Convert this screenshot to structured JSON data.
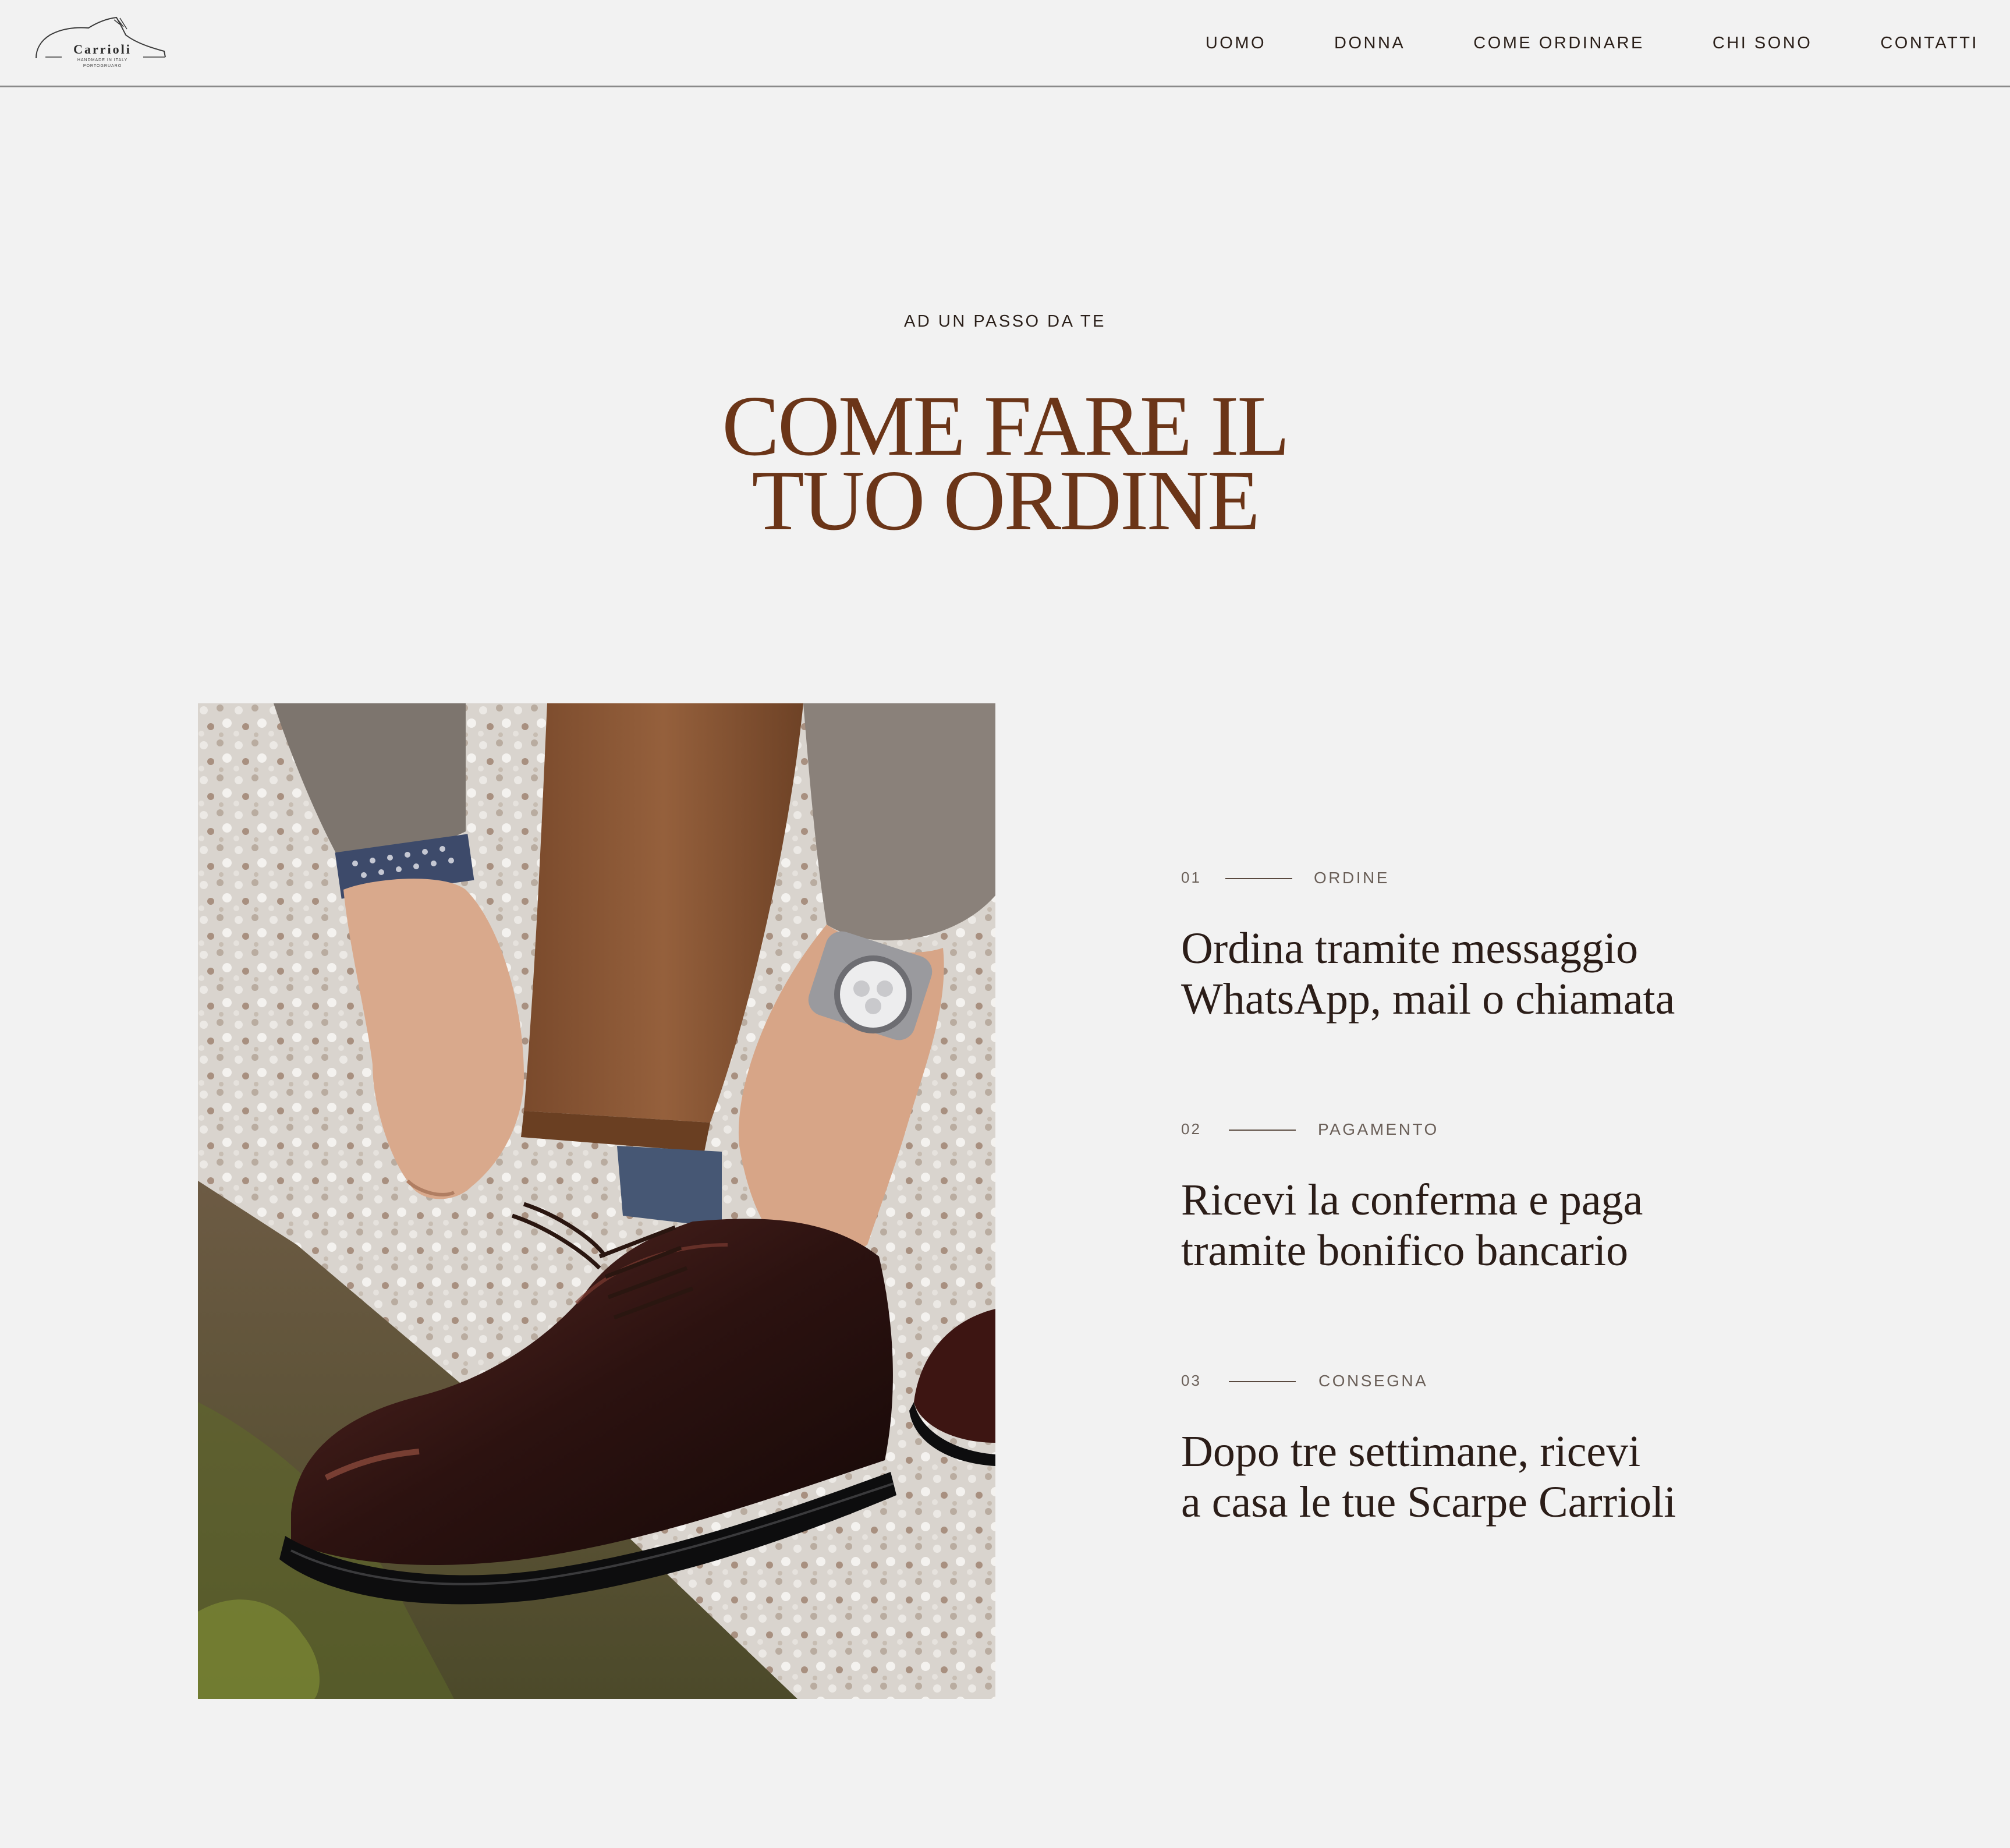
{
  "header": {
    "logo": {
      "name": "Carrioli",
      "line1": "HANDMADE IN ITALY",
      "line2": "PORTOGRUARO"
    },
    "nav": [
      {
        "label": "UOMO"
      },
      {
        "label": "DONNA"
      },
      {
        "label": "COME ORDINARE"
      },
      {
        "label": "CHI SONO"
      },
      {
        "label": "CONTATTI"
      }
    ]
  },
  "hero": {
    "kicker": "AD UN PASSO DA TE",
    "title_line1": "COME FARE IL",
    "title_line2": "TUO ORDINE"
  },
  "steps": [
    {
      "num": "01",
      "label": "ORDINE",
      "line1": "Ordina tramite messaggio",
      "line2": "WhatsApp, mail o chiamata"
    },
    {
      "num": "02",
      "label": "PAGAMENTO",
      "line1": "Ricevi la conferma e paga",
      "line2": "tramite bonifico bancario"
    },
    {
      "num": "03",
      "label": "CONSEGNA",
      "line1": "Dopo tre settimane, ricevi",
      "line2": "a casa le tue Scarpe Carrioli"
    }
  ],
  "colors": {
    "background": "#f2f2f2",
    "title": "#6b3518",
    "text": "#2b1d18",
    "muted": "#6a5f58"
  }
}
